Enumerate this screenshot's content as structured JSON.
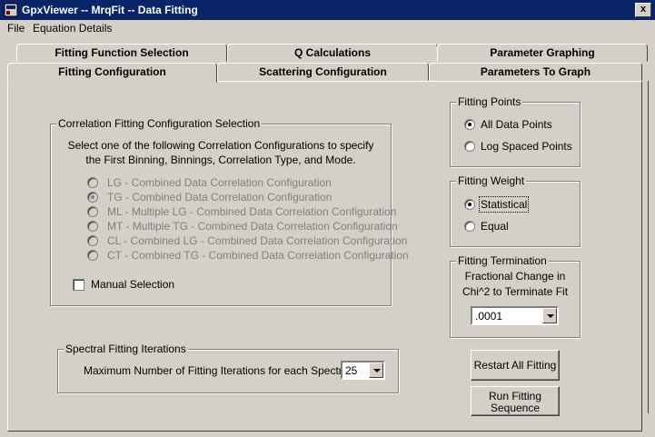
{
  "window": {
    "title": "GpxViewer -- MrqFit -- Data Fitting",
    "close_label": "x"
  },
  "menu": {
    "items": [
      "File",
      "Equation Details"
    ]
  },
  "tabs": {
    "back_row": [
      "Fitting Function Selection",
      "Q  Calculations",
      "Parameter Graphing"
    ],
    "front_row": [
      "Fitting Configuration",
      "Scattering Configuration",
      "Parameters To Graph"
    ],
    "selected": "Fitting Configuration"
  },
  "correlation": {
    "legend": "Correlation Fitting Configuration Selection",
    "instructions": [
      "Select one of the following Correlation Configurations to specify",
      "the First Binning, Binnings, Correlation Type, and Mode."
    ],
    "options": [
      "LG - Combined Data Correlation Configuration",
      "TG - Combined Data Correlation Configuration",
      "ML - Multiple LG - Combined Data Correlation Configuration",
      "MT - Multiple TG - Combined Data Correlation Configuration",
      "CL - Combined LG - Combined Data Correlation Configuration",
      "CT - Combined TG - Combined Data Correlation Configuration"
    ],
    "selected_index": 1,
    "manual_label": "Manual Selection"
  },
  "spectral": {
    "legend": "Spectral Fitting Iterations",
    "label": "Maximum Number of Fitting Iterations for each Spectra",
    "value": "25"
  },
  "fitting_points": {
    "legend": "Fitting Points",
    "options": [
      "All Data Points",
      "Log Spaced Points"
    ],
    "selected_index": 0
  },
  "fitting_weight": {
    "legend": "Fitting Weight",
    "options": [
      "Statistical",
      "Equal"
    ],
    "selected_index": 0
  },
  "fitting_termination": {
    "legend": "Fitting Termination",
    "label": [
      "Fractional Change in",
      "Chi^2 to Terminate Fit"
    ],
    "value": ".0001"
  },
  "buttons": {
    "restart": "Restart All Fitting",
    "run": [
      "Run Fitting",
      "Sequence"
    ]
  }
}
